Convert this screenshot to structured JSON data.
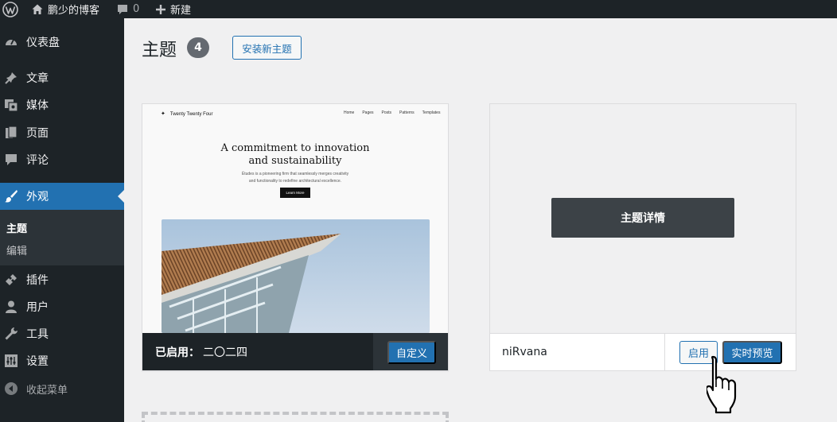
{
  "admin_bar": {
    "site_name": "鹏少的博客",
    "comments_count": "0",
    "new_label": "新建"
  },
  "sidebar": {
    "items": [
      {
        "label": "仪表盘",
        "icon": "dashboard-icon"
      },
      {
        "label": "文章",
        "icon": "pin-icon"
      },
      {
        "label": "媒体",
        "icon": "media-icon"
      },
      {
        "label": "页面",
        "icon": "page-icon"
      },
      {
        "label": "评论",
        "icon": "comment-icon"
      },
      {
        "label": "外观",
        "icon": "brush-icon",
        "current": true
      },
      {
        "label": "插件",
        "icon": "plugin-icon"
      },
      {
        "label": "用户",
        "icon": "user-icon"
      },
      {
        "label": "工具",
        "icon": "wrench-icon"
      },
      {
        "label": "设置",
        "icon": "settings-icon"
      }
    ],
    "submenu": [
      {
        "label": "主题",
        "active": true
      },
      {
        "label": "编辑",
        "active": false
      }
    ],
    "collapse_label": "收起菜单"
  },
  "header": {
    "title": "主题",
    "count": "4",
    "add_new_label": "安装新主题"
  },
  "themes": [
    {
      "preview": {
        "site_title": "Twenty Twenty Four",
        "nav": [
          "Home",
          "Pages",
          "Posts",
          "Patterns",
          "Templates"
        ],
        "heading_line1": "A commitment to innovation",
        "heading_line2": "and sustainability",
        "body_line1": "Études is a pioneering firm that seamlessly merges creativity",
        "body_line2": "and functionality to redefine architectural excellence.",
        "button": "Learn More"
      },
      "active_prefix": "已启用：",
      "name": "二〇二四",
      "customize_label": "自定义"
    },
    {
      "details_label": "主题详情",
      "name": "niRvana",
      "activate_label": "启用",
      "live_preview_label": "实时预览"
    }
  ],
  "colors": {
    "accent": "#2271b1",
    "admin_dark": "#1d2327",
    "background": "#f0f0f1"
  }
}
